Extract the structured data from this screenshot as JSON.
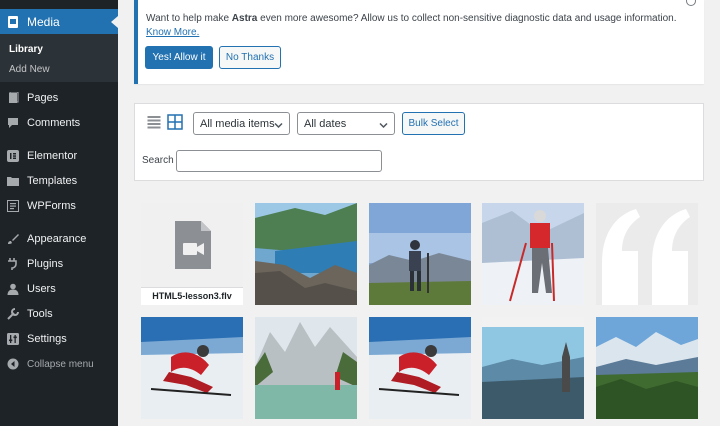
{
  "sidebar": {
    "media_label": "Media",
    "sub_library": "Library",
    "sub_add_new": "Add New",
    "items": [
      {
        "label": "Pages",
        "icon": "pages-icon"
      },
      {
        "label": "Comments",
        "icon": "comments-icon"
      },
      {
        "label": "Elementor",
        "icon": "elementor-icon"
      },
      {
        "label": "Templates",
        "icon": "folder-icon"
      },
      {
        "label": "WPForms",
        "icon": "forms-icon"
      },
      {
        "label": "Appearance",
        "icon": "paintbrush-icon"
      },
      {
        "label": "Plugins",
        "icon": "plugin-icon"
      },
      {
        "label": "Users",
        "icon": "user-icon"
      },
      {
        "label": "Tools",
        "icon": "wrench-icon"
      },
      {
        "label": "Settings",
        "icon": "settings-icon"
      },
      {
        "label": "Collapse menu",
        "icon": "collapse-icon"
      }
    ]
  },
  "notice": {
    "text_before": "Want to help make ",
    "brand": "Astra",
    "text_after": " even more awesome? Allow us to collect non-sensitive diagnostic data and usage information. ",
    "link": "Know More.",
    "yes_button": "Yes! Allow it",
    "no_button": "No Thanks"
  },
  "toolbar": {
    "filter_type": "All media items",
    "filter_date": "All dates",
    "bulk_select": "Bulk Select",
    "search_label": "Search",
    "search_value": ""
  },
  "media_grid": [
    {
      "type": "file",
      "filename": "HTML5-lesson3.flv"
    },
    {
      "type": "image",
      "subject": "lake-cliff"
    },
    {
      "type": "image",
      "subject": "hiker-mountains"
    },
    {
      "type": "image",
      "subject": "skier-red-jacket"
    },
    {
      "type": "image",
      "subject": "quote-marks"
    },
    {
      "type": "image",
      "subject": "skier-turning"
    },
    {
      "type": "image",
      "subject": "mountain-lake"
    },
    {
      "type": "image",
      "subject": "skier-turning"
    },
    {
      "type": "image",
      "subject": "valley-church"
    },
    {
      "type": "image",
      "subject": "alpine-village"
    }
  ],
  "colors": {
    "accent": "#2271b1",
    "sidebar": "#1d2327",
    "sidebar_sub": "#2c3338"
  }
}
